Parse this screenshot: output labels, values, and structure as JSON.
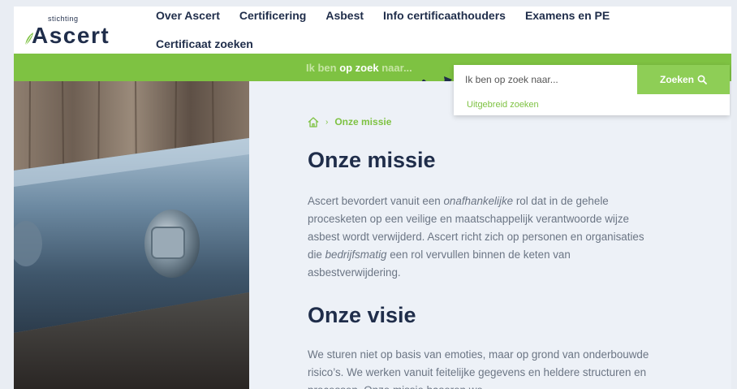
{
  "logo": {
    "small": "stichting",
    "main": "Ascert"
  },
  "nav": {
    "row1": [
      "Over Ascert",
      "Certificering",
      "Asbest",
      "Info certificaathouders",
      "Examens en PE"
    ],
    "row2": [
      "Certificaat zoeken"
    ]
  },
  "greenbar": {
    "prefix": "Ik ben ",
    "bold": "op zoek",
    "suffix": " naar..."
  },
  "search": {
    "placeholder": "Ik ben op zoek naar...",
    "button": "Zoeken",
    "advanced": "Uitgebreid zoeken"
  },
  "breadcrumb": {
    "current": "Onze missie",
    "separator": "›"
  },
  "mission": {
    "title": "Onze missie",
    "p_a": "Ascert bevordert vanuit een ",
    "p_em1": "onafhankelijke",
    "p_b": " rol dat in de gehele procesketen op een veilige en maatschappelijk verantwoorde wijze asbest wordt verwijderd. Ascert richt zich op personen en organisaties die ",
    "p_em2": "bedrijfsmatig",
    "p_c": " een rol vervullen binnen de keten van asbestverwijdering."
  },
  "vision": {
    "title": "Onze visie",
    "p": "We sturen niet op basis van emoties, maar op grond van onderbouwde risico’s. We werken vanuit feitelijke gegevens en heldere structuren en processen. Onze missie baseren we"
  },
  "colors": {
    "green": "#7ec242",
    "navy": "#1f2d4a",
    "text": "#6b7584"
  },
  "icons": [
    "leaf-icon",
    "search-icon",
    "home-icon",
    "arrow-icon"
  ]
}
